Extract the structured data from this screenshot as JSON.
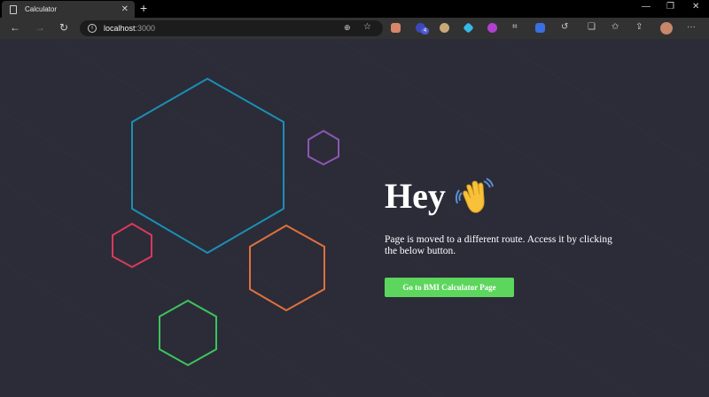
{
  "browser": {
    "tab_title": "Calculator",
    "tab_close": "✕",
    "new_tab": "+",
    "minimize": "—",
    "restore": "❐",
    "close": "✕",
    "back": "←",
    "forward": "→",
    "reload": "↻",
    "info": "i",
    "url_host": "localhost",
    "url_port": ":3000",
    "zoom_icon": "⊕",
    "favorite_icon": "☆",
    "extension_badge": "4",
    "more": "···"
  },
  "page": {
    "heading": "Hey",
    "description": "Page is moved to a different route. Access it by clicking the below button.",
    "button_label": "Go to BMI Calculator Page"
  },
  "colors": {
    "background": "#2b2c38",
    "hex_blue": "#1b8fb4",
    "hex_purple": "#8e56b3",
    "hex_red": "#d93a5a",
    "hex_orange": "#e0703c",
    "hex_green": "#3cc45b",
    "button": "#5cd65c"
  }
}
